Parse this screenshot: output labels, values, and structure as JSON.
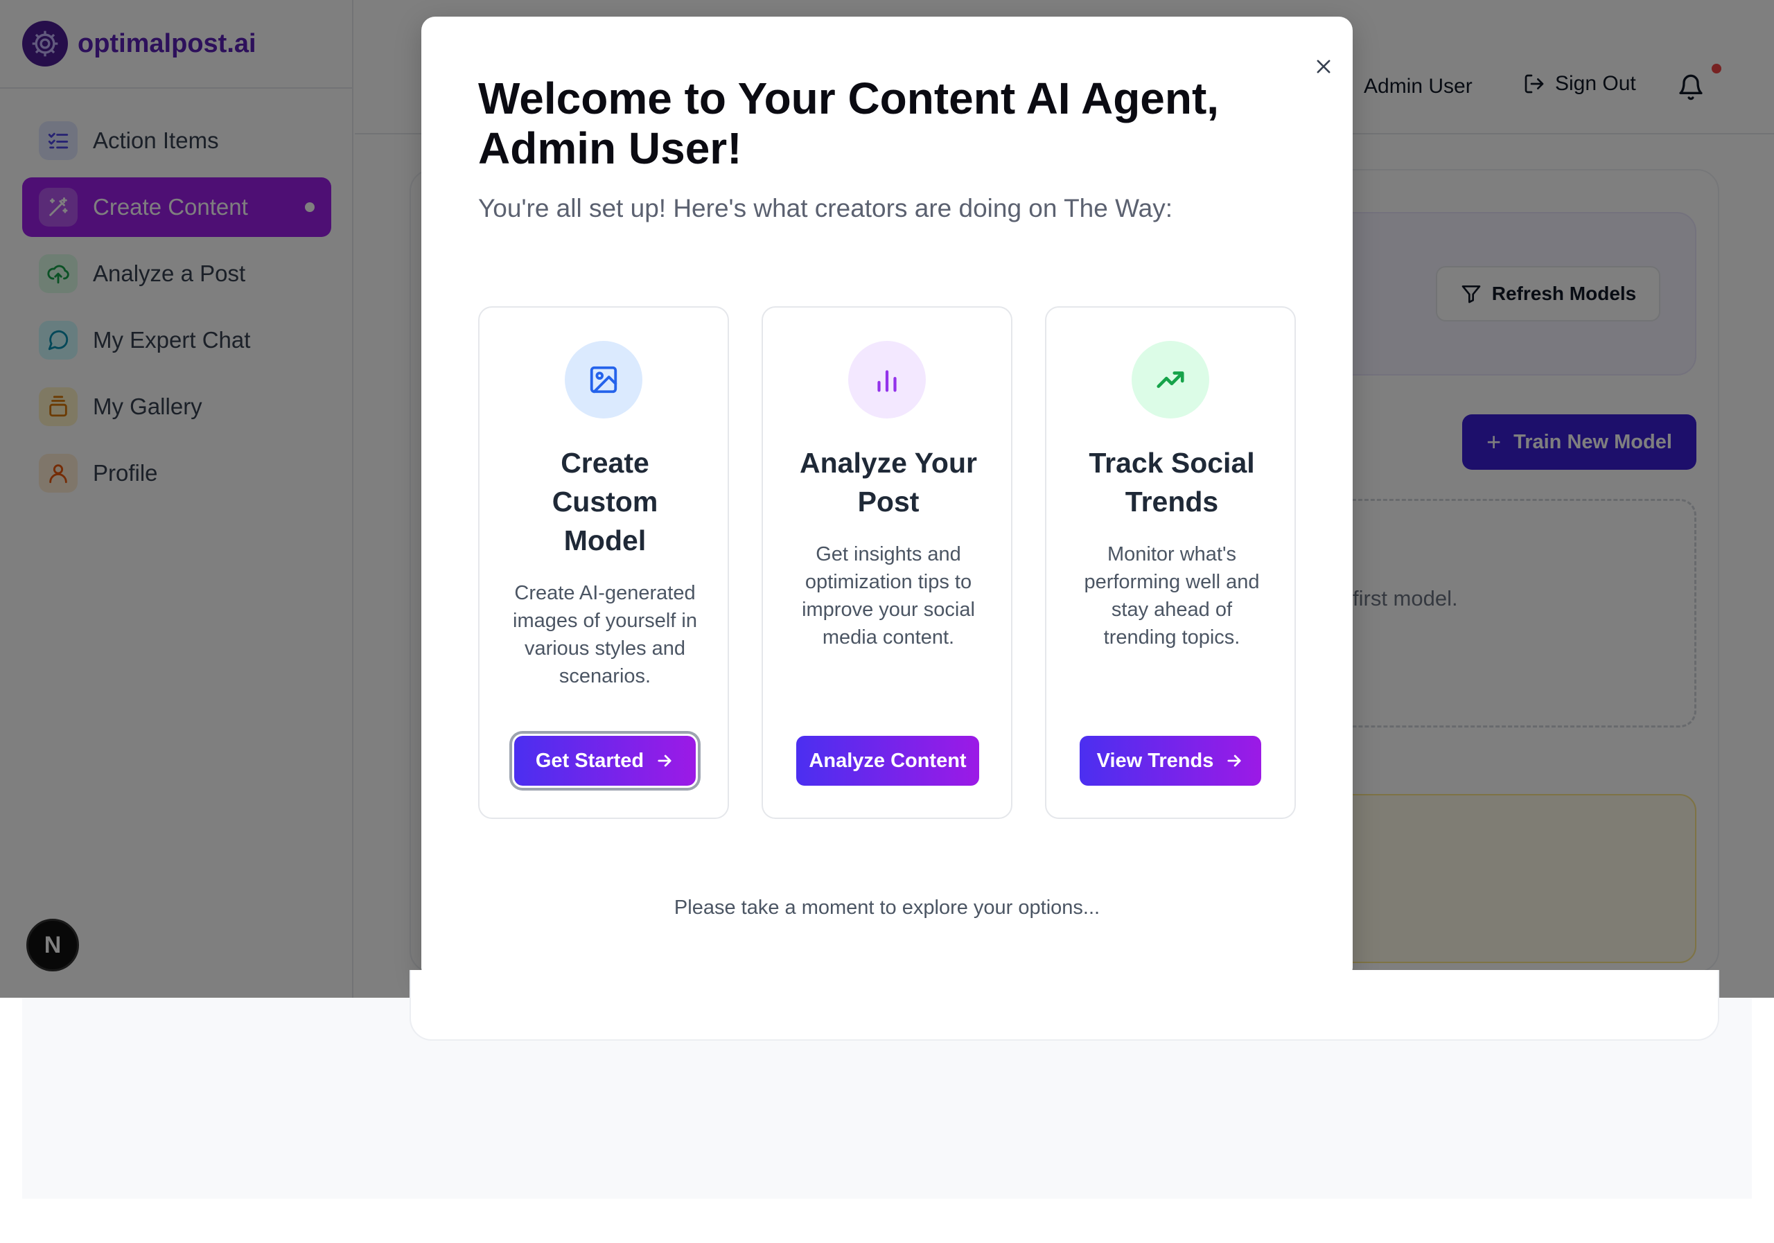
{
  "brand": {
    "name": "optimalpost.ai",
    "logo_icon": "gear-logo-icon"
  },
  "sidebar": {
    "items": [
      {
        "label": "Action Items",
        "icon": "checklist-icon",
        "icon_bg": "#e0e7ff",
        "icon_color": "#4f46e5"
      },
      {
        "label": "Create Content",
        "icon": "magic-wand-icon",
        "icon_bg": "#c084fc",
        "icon_color": "#ffffff",
        "active": true
      },
      {
        "label": "Analyze a Post",
        "icon": "upload-cloud-icon",
        "icon_bg": "#dcfce7",
        "icon_color": "#16a34a"
      },
      {
        "label": "My Expert Chat",
        "icon": "chat-bubble-icon",
        "icon_bg": "#cffafe",
        "icon_color": "#0891b2"
      },
      {
        "label": "My Gallery",
        "icon": "stack-icon",
        "icon_bg": "#fef3c7",
        "icon_color": "#d97706"
      },
      {
        "label": "Profile",
        "icon": "user-icon",
        "icon_bg": "#ffedd5",
        "icon_color": "#ea580c"
      }
    ],
    "framework_badge": "N"
  },
  "header": {
    "user_name": "Admin User",
    "sign_out_label": "Sign Out",
    "notification_dot": true
  },
  "background_page": {
    "refresh_models_label": "Refresh Models",
    "train_new_model_label": "Train New Model",
    "empty_state_text_visible": "first model."
  },
  "modal": {
    "title": "Welcome to Your Content AI Agent, Admin User!",
    "subtitle": "You're all set up! Here's what creators are doing on The Way:",
    "cards": [
      {
        "title": "Create Custom Model",
        "description": "Create AI-generated images of yourself in various styles and scenarios.",
        "button": "Get Started",
        "icon": "image-icon",
        "icon_bg": "#dbeafe",
        "icon_color": "#2563eb"
      },
      {
        "title": "Analyze Your Post",
        "description": "Get insights and optimization tips to improve your social media content.",
        "button": "Analyze Content",
        "icon": "bar-chart-icon",
        "icon_bg": "#f3e8ff",
        "icon_color": "#9333ea"
      },
      {
        "title": "Track Social Trends",
        "description": "Monitor what's performing well and stay ahead of trending topics.",
        "button": "View Trends",
        "icon": "trending-up-icon",
        "icon_bg": "#dcfce7",
        "icon_color": "#16a34a"
      }
    ],
    "footer": "Please take a moment to explore your options...",
    "close_icon": "close-icon"
  },
  "colors": {
    "active_nav": "#9d1fe8",
    "primary_button": "#3b1fd6",
    "gradient_start": "#4b2ff0",
    "gradient_end": "#9c1ae6",
    "brand": "#5b21b6"
  }
}
